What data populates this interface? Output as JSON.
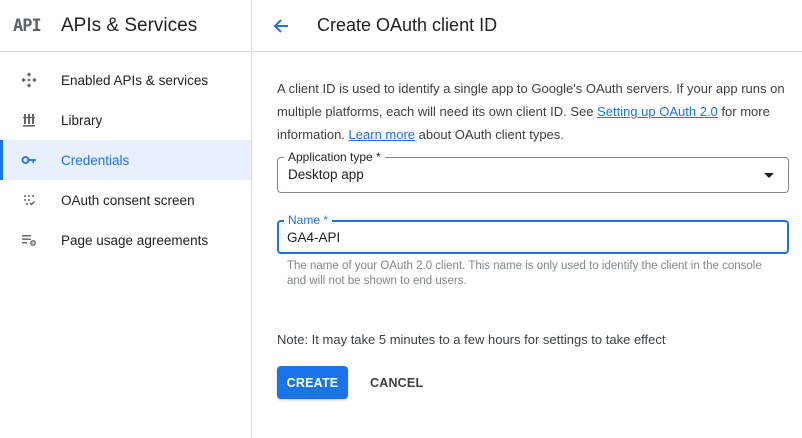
{
  "sidebar": {
    "logo": "API",
    "title": "APIs & Services",
    "items": [
      {
        "label": "Enabled APIs & services",
        "icon": "enabled-apis-icon"
      },
      {
        "label": "Library",
        "icon": "library-icon"
      },
      {
        "label": "Credentials",
        "icon": "key-icon",
        "active": true
      },
      {
        "label": "OAuth consent screen",
        "icon": "oauth-consent-icon"
      },
      {
        "label": "Page usage agreements",
        "icon": "settings-list-icon"
      }
    ]
  },
  "header": {
    "title": "Create OAuth client ID"
  },
  "intro": {
    "text_1": "A client ID is used to identify a single app to Google's OAuth servers. If your app runs on multiple platforms, each will need its own client ID. See ",
    "link_1": "Setting up OAuth 2.0",
    "text_2": " for more information. ",
    "link_2": "Learn more",
    "text_3": " about OAuth client types."
  },
  "form": {
    "app_type_label": "Application type *",
    "app_type_value": "Desktop app",
    "name_label": "Name *",
    "name_value": "GA4-API",
    "name_hint": "The name of your OAuth 2.0 client. This name is only used to identify the client in the console and will not be shown to end users."
  },
  "note": "Note: It may take 5 minutes to a few hours for settings to take effect",
  "actions": {
    "create": "CREATE",
    "cancel": "CANCEL"
  },
  "colors": {
    "accent": "#1a73e8",
    "active_bg": "#e8f0fe",
    "border": "#dadce0"
  }
}
